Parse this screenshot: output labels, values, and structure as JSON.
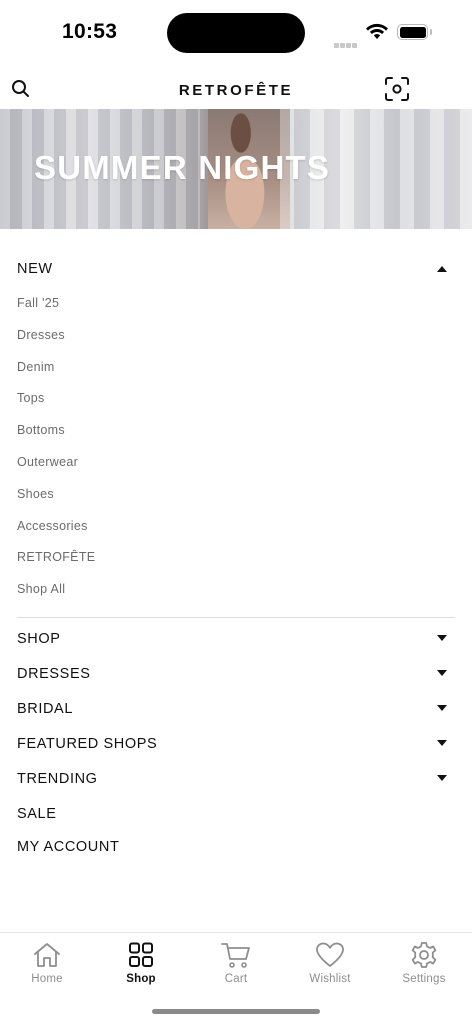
{
  "status_bar": {
    "time": "10:53"
  },
  "header": {
    "brand": "RETROFÊTE",
    "search_icon": "search-icon",
    "scan_icon": "scan-icon"
  },
  "banner": {
    "title": "SUMMER NIGHTS"
  },
  "menu": {
    "expanded_section": {
      "label": "NEW",
      "items": [
        "Fall '25",
        "Dresses",
        "Denim",
        "Tops",
        "Bottoms",
        "Outerwear",
        "Shoes",
        "Accessories",
        "RETROFÊTE",
        "Shop All"
      ]
    },
    "categories": [
      {
        "label": "SHOP",
        "has_dropdown": true
      },
      {
        "label": "DRESSES",
        "has_dropdown": true
      },
      {
        "label": "BRIDAL",
        "has_dropdown": true
      },
      {
        "label": "FEATURED SHOPS",
        "has_dropdown": true
      },
      {
        "label": "TRENDING",
        "has_dropdown": true
      },
      {
        "label": "SALE",
        "has_dropdown": false
      },
      {
        "label": "MY ACCOUNT",
        "has_dropdown": false
      }
    ]
  },
  "tab_bar": {
    "active": "Shop",
    "tabs": [
      {
        "label": "Home",
        "icon": "home-icon"
      },
      {
        "label": "Shop",
        "icon": "grid-icon"
      },
      {
        "label": "Cart",
        "icon": "cart-icon"
      },
      {
        "label": "Wishlist",
        "icon": "heart-icon"
      },
      {
        "label": "Settings",
        "icon": "gear-icon"
      }
    ]
  },
  "colors": {
    "text": "#111111",
    "muted": "#6b6b6b",
    "inactive_tab": "#8e8e8e",
    "divider": "#dcdcdc"
  }
}
